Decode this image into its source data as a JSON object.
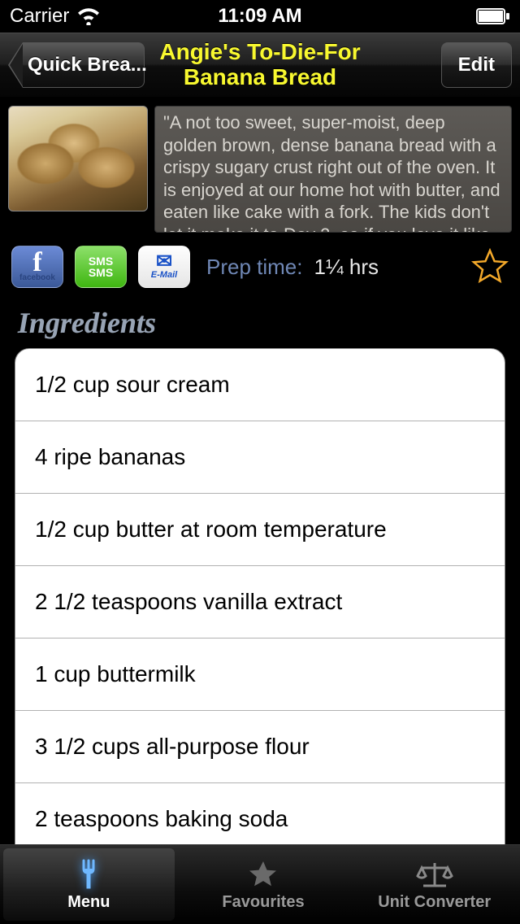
{
  "status_bar": {
    "carrier": "Carrier",
    "time": "11:09 AM"
  },
  "nav": {
    "back_label": "Quick Brea...",
    "title": "Angie's To-Die-For Banana Bread",
    "edit_label": "Edit"
  },
  "recipe": {
    "description": "\"A not too sweet, super-moist, deep golden brown, dense banana bread with a crispy sugary crust right out of the oven. It is enjoyed at our home hot with butter, and eaten like cake with a fork. The kids don't let it make it to Day 2, so if you love it like we do, get it while",
    "prep_label": "Prep time:",
    "prep_value": "1¼ hrs"
  },
  "share": {
    "facebook_label": "facebook",
    "sms_label": "SMS",
    "email_label": "E-Mail"
  },
  "section_title": "Ingredients",
  "ingredients": [
    "1/2 cup sour cream",
    "4 ripe bananas",
    "1/2 cup butter at room temperature",
    "2 1/2 teaspoons vanilla extract",
    "1 cup buttermilk",
    "3 1/2 cups all-purpose flour",
    "2 teaspoons baking soda"
  ],
  "tabs": {
    "menu": "Menu",
    "favourites": "Favourites",
    "converter": "Unit Converter"
  }
}
